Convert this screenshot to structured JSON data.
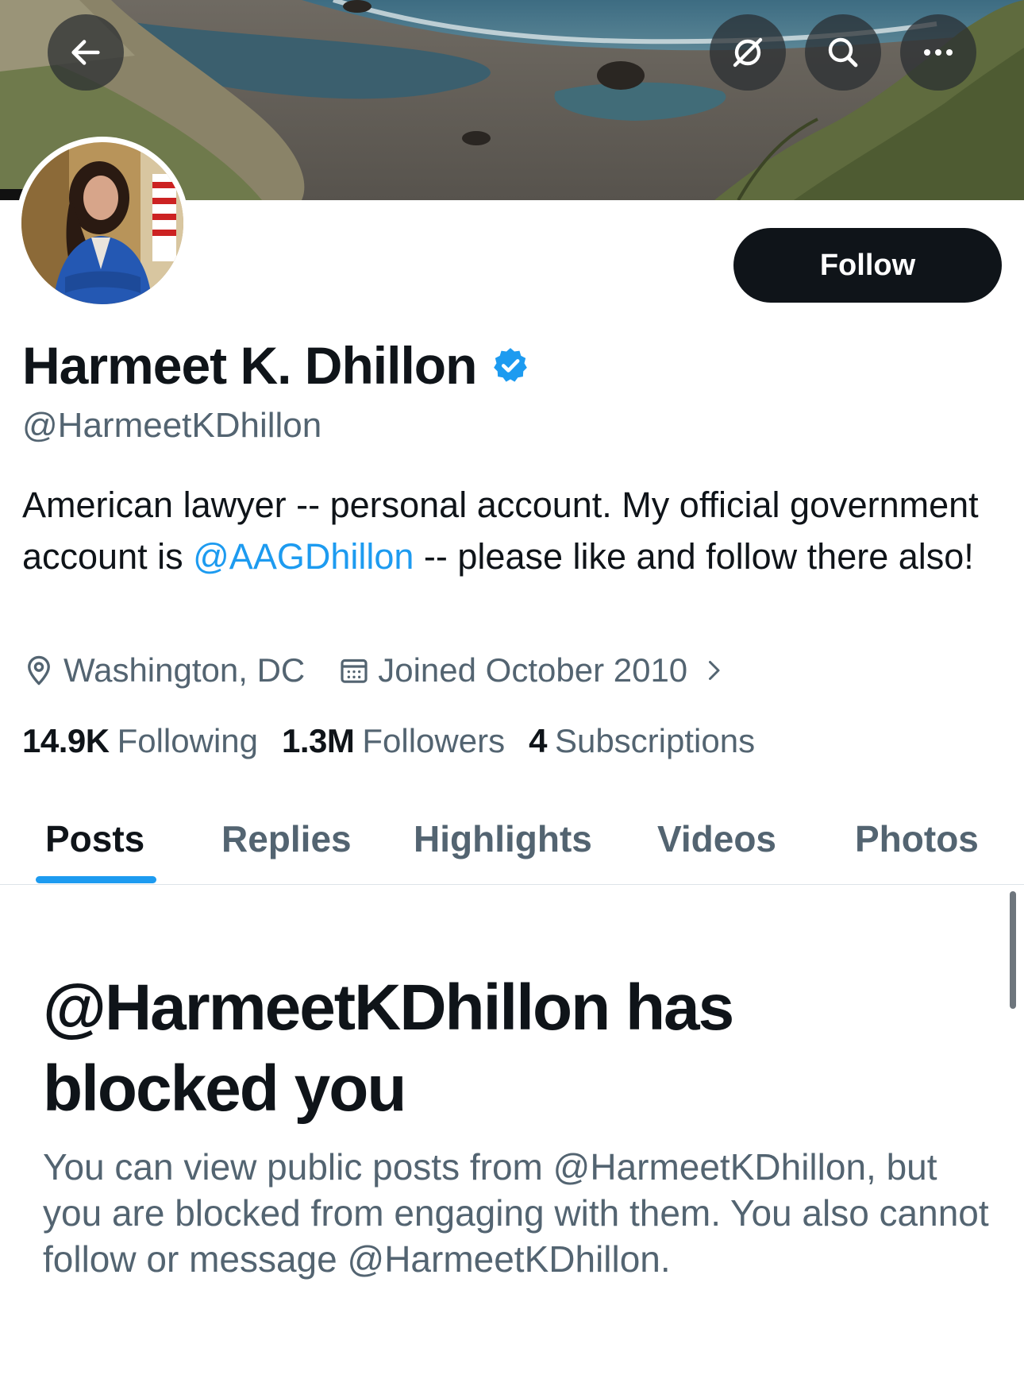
{
  "header": {
    "back_icon": "arrow-left-icon",
    "grok_icon": "slashed-circle-icon",
    "search_icon": "search-icon",
    "more_icon": "more-horizontal-icon"
  },
  "profile": {
    "follow_label": "Follow",
    "display_name": "Harmeet K. Dhillon",
    "verified_icon": "verified-badge-icon",
    "handle": "@HarmeetKDhillon",
    "bio_before": "American lawyer -- personal account. My official government account is ",
    "bio_mention": "@AAGDhillon",
    "bio_after": " -- please like and follow there also!",
    "location": "Washington, DC",
    "joined": "Joined October 2010",
    "stats": {
      "following_count": "14.9K",
      "following_label": "Following",
      "followers_count": "1.3M",
      "followers_label": "Followers",
      "subscriptions_count": "4",
      "subscriptions_label": "Subscriptions"
    }
  },
  "tabs": [
    {
      "label": "Posts",
      "active": true
    },
    {
      "label": "Replies",
      "active": false
    },
    {
      "label": "Highlights",
      "active": false
    },
    {
      "label": "Videos",
      "active": false
    },
    {
      "label": "Photos",
      "active": false
    }
  ],
  "blocked": {
    "title": "@HarmeetKDhillon has blocked you",
    "message": "You can view public posts from @HarmeetKDhillon, but you are blocked from engaging with them. You also cannot follow or message @HarmeetKDhillon."
  },
  "colors": {
    "accent": "#1d9bf0",
    "text": "#0f1419",
    "secondary": "#536471",
    "button_dark": "#0f1419"
  }
}
